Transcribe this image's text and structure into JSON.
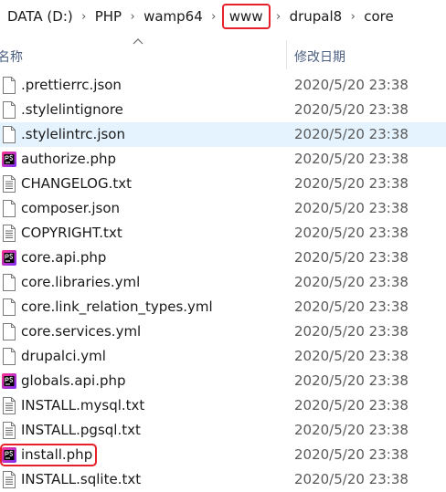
{
  "breadcrumb": {
    "items": [
      {
        "label": "DATA (D:)"
      },
      {
        "label": "PHP"
      },
      {
        "label": "wamp64"
      },
      {
        "label": "www"
      },
      {
        "label": "drupal8"
      },
      {
        "label": "core"
      }
    ],
    "highlighted_item": "www"
  },
  "header": {
    "name_label": "名称",
    "date_label": "修改日期",
    "sort": "ascending"
  },
  "files": [
    {
      "name": ".prettierrc.json",
      "date": "2020/5/20 23:38",
      "icon": "file-icon"
    },
    {
      "name": ".stylelintignore",
      "date": "2020/5/20 23:38",
      "icon": "file-icon"
    },
    {
      "name": ".stylelintrc.json",
      "date": "2020/5/20 23:38",
      "icon": "file-icon"
    },
    {
      "name": "authorize.php",
      "date": "2020/5/20 23:38",
      "icon": "phpstorm-icon"
    },
    {
      "name": "CHANGELOG.txt",
      "date": "2020/5/20 23:38",
      "icon": "text-file-icon"
    },
    {
      "name": "composer.json",
      "date": "2020/5/20 23:38",
      "icon": "file-icon"
    },
    {
      "name": "COPYRIGHT.txt",
      "date": "2020/5/20 23:38",
      "icon": "text-file-icon"
    },
    {
      "name": "core.api.php",
      "date": "2020/5/20 23:38",
      "icon": "phpstorm-icon"
    },
    {
      "name": "core.libraries.yml",
      "date": "2020/5/20 23:38",
      "icon": "file-icon"
    },
    {
      "name": "core.link_relation_types.yml",
      "date": "2020/5/20 23:38",
      "icon": "file-icon"
    },
    {
      "name": "core.services.yml",
      "date": "2020/5/20 23:38",
      "icon": "file-icon"
    },
    {
      "name": "drupalci.yml",
      "date": "2020/5/20 23:38",
      "icon": "file-icon"
    },
    {
      "name": "globals.api.php",
      "date": "2020/5/20 23:38",
      "icon": "phpstorm-icon"
    },
    {
      "name": "INSTALL.mysql.txt",
      "date": "2020/5/20 23:38",
      "icon": "text-file-icon"
    },
    {
      "name": "INSTALL.pgsql.txt",
      "date": "2020/5/20 23:38",
      "icon": "text-file-icon"
    },
    {
      "name": "install.php",
      "date": "2020/5/20 23:38",
      "icon": "phpstorm-icon"
    },
    {
      "name": "INSTALL.sqlite.txt",
      "date": "2020/5/20 23:38",
      "icon": "text-file-icon"
    }
  ],
  "selected_file": ".stylelintrc.json",
  "highlighted_file": "install.php",
  "colors": {
    "highlight_border": "#e8202a",
    "selection_background": "#e5f3ff",
    "header_text": "#4d6082",
    "phpstorm_gradient_start": "#ff318c",
    "phpstorm_gradient_end": "#7b2ff7"
  }
}
